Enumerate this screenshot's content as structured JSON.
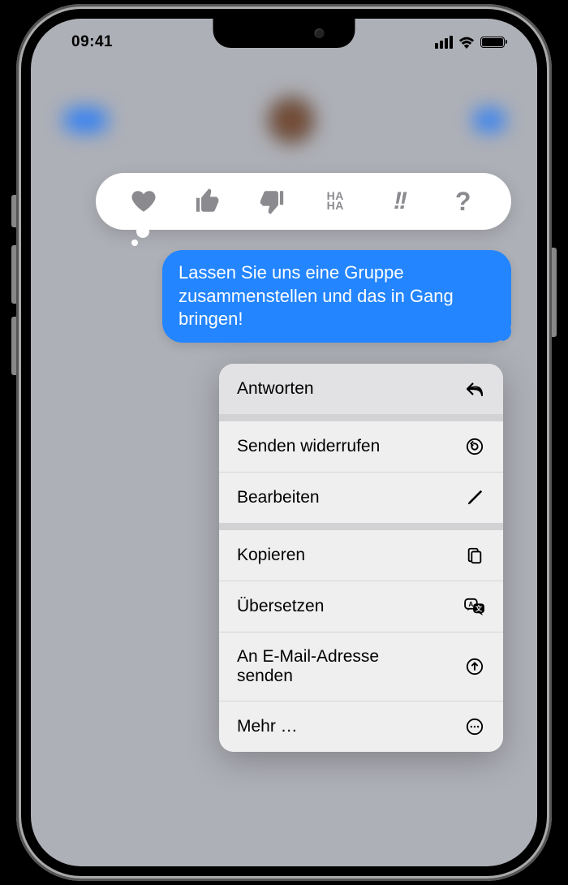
{
  "status": {
    "time": "09:41"
  },
  "message": {
    "text": "Lassen Sie uns eine Gruppe zusammenstellen und das in Gang bringen!"
  },
  "tapback": {
    "haha": "HA\nHA",
    "bangs": "!!",
    "question": "?"
  },
  "menu": {
    "reply": "Antworten",
    "undo_send": "Senden widerrufen",
    "edit": "Bearbeiten",
    "copy": "Kopieren",
    "translate": "Übersetzen",
    "send_email": "An E-Mail-Adresse senden",
    "more": "Mehr …"
  }
}
